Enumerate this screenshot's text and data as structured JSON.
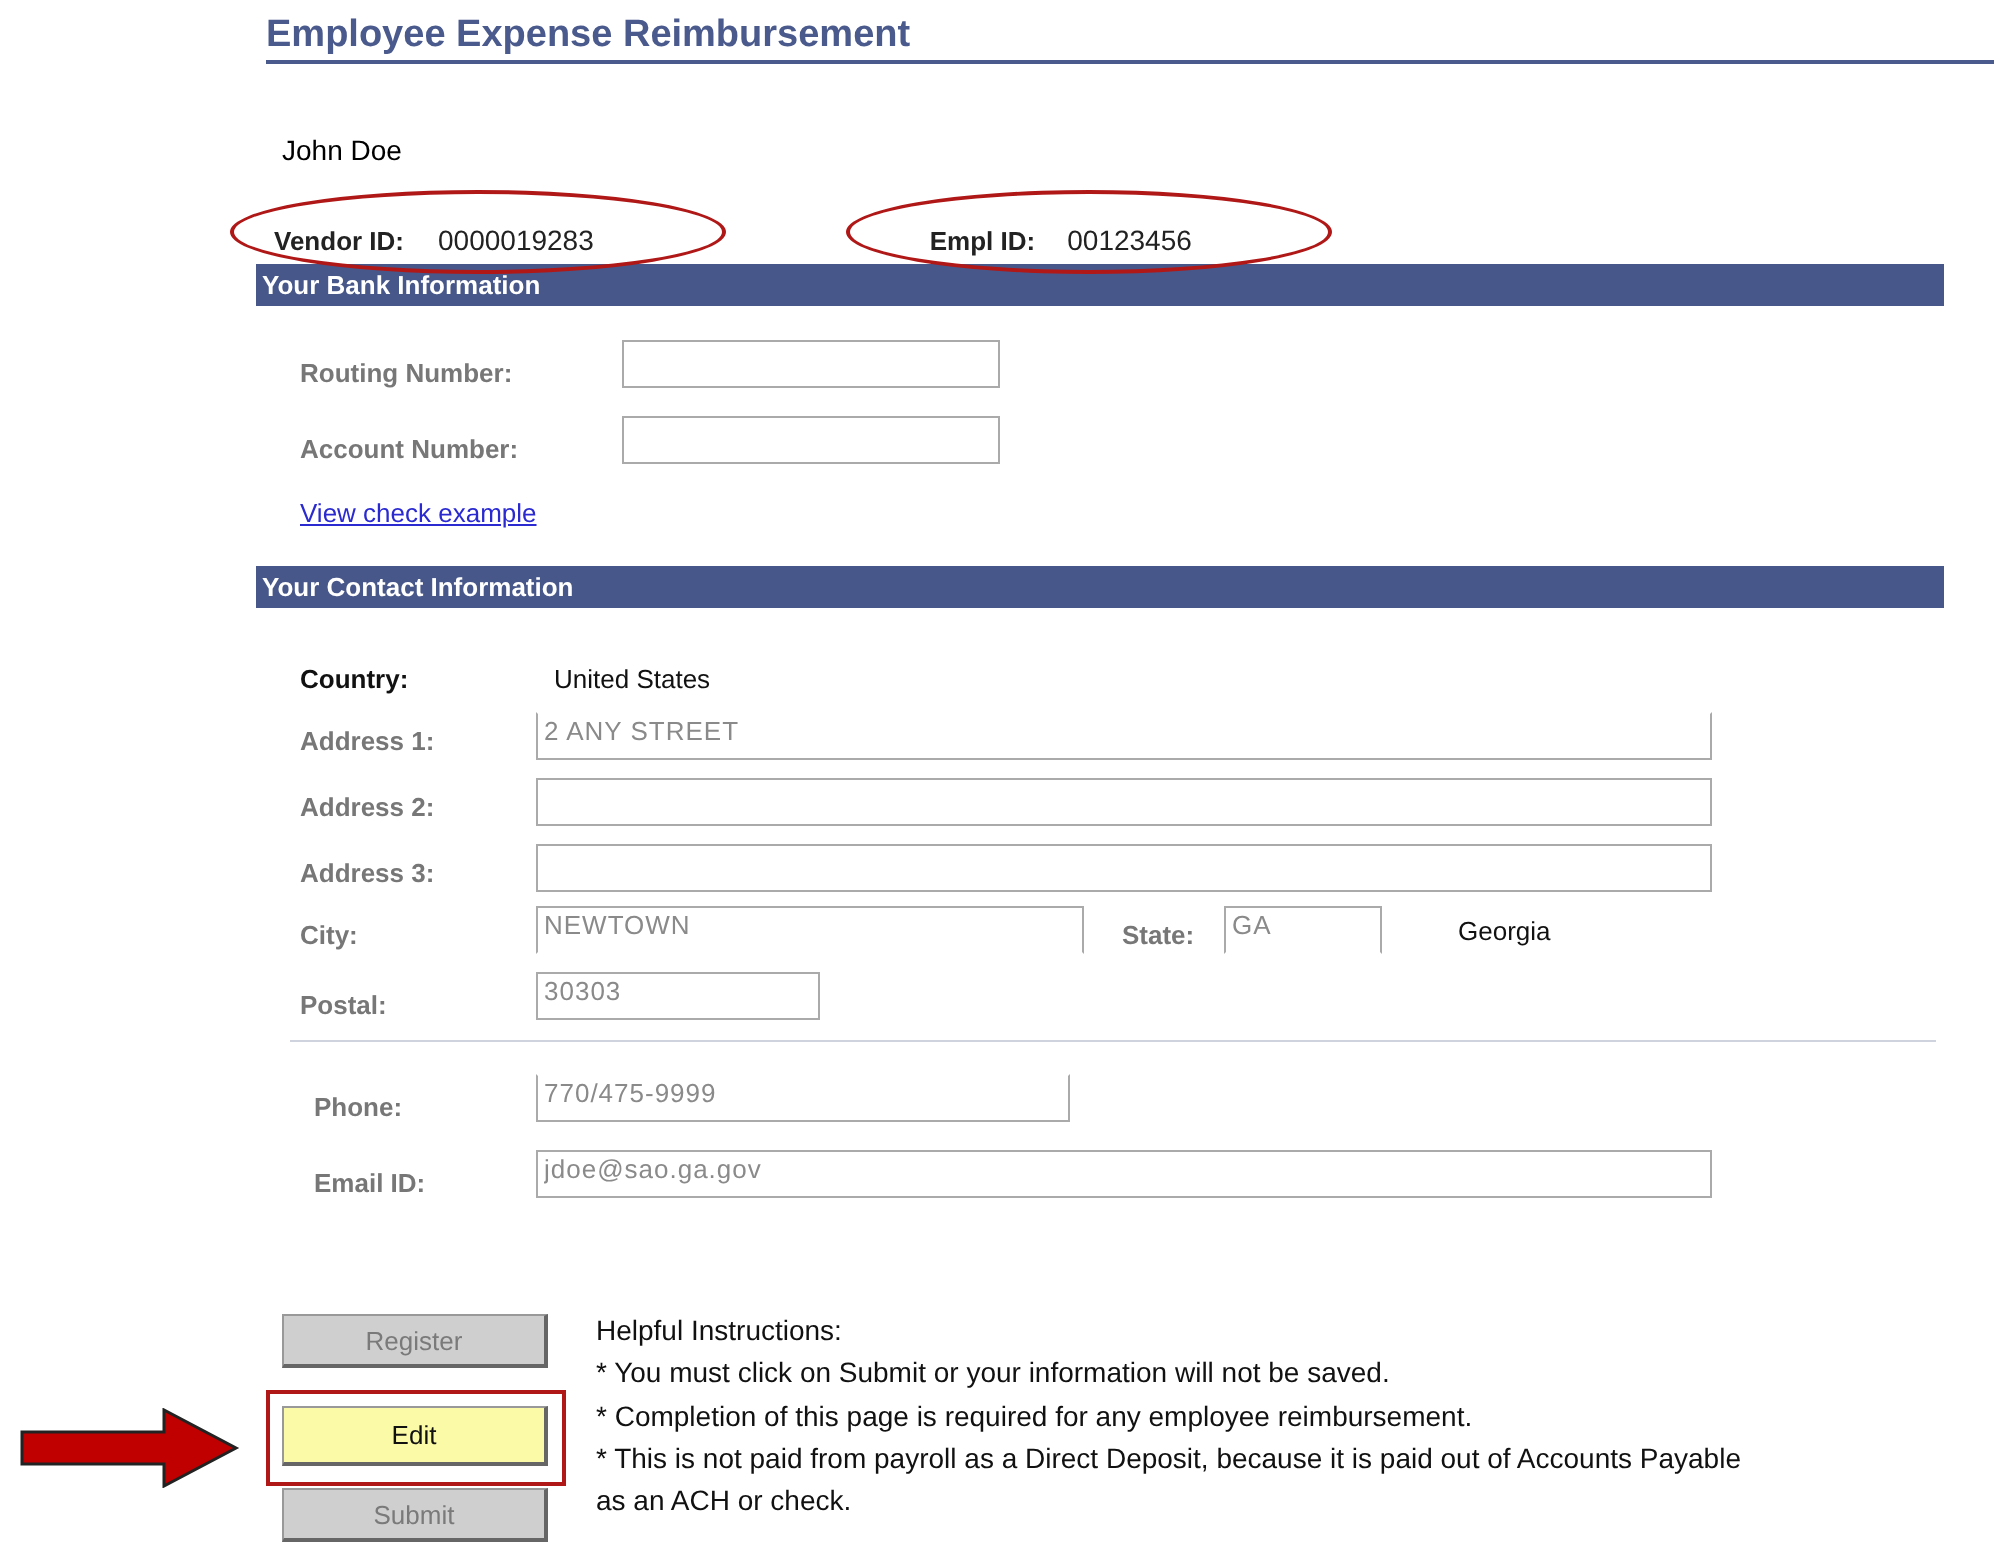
{
  "title": "Employee Expense Reimbursement",
  "employee_name": "John Doe",
  "ids": [
    {
      "label": "Vendor ID:",
      "value": "0000019283",
      "circled": true
    },
    {
      "label": "Empl ID:",
      "value": "00123456",
      "circled": true
    }
  ],
  "bank_section": {
    "heading": "Your Bank Information",
    "fields": [
      {
        "label": "Routing Number:"
      },
      {
        "label": "Account Number:"
      }
    ],
    "link": "View check example"
  },
  "contact_section": {
    "heading": "Your Contact Information",
    "country": {
      "label": "Country:",
      "value": "United States"
    },
    "addresses": [
      {
        "label": "Address 1:",
        "value": "2 ANY STREET"
      },
      {
        "label": "Address 2:"
      },
      {
        "label": "Address 3:"
      }
    ],
    "city": {
      "label": "City:",
      "value": "NEWTOWN"
    },
    "state": {
      "label": "State:",
      "value": "GA",
      "name": "Georgia"
    },
    "postal": {
      "label": "Postal:",
      "value": "30303"
    },
    "phone": {
      "label": "Phone:",
      "value": "770/475-9999"
    },
    "email": {
      "label": "Email ID:",
      "value": "jdoe@sao.ga.gov"
    }
  },
  "buttons": [
    {
      "label": "Register",
      "disabled": true,
      "highlighted": false
    },
    {
      "label": "Edit",
      "disabled": false,
      "highlighted": true
    },
    {
      "label": "Submit",
      "disabled": true,
      "highlighted": false
    }
  ],
  "instructions": {
    "heading": "Helpful Instructions:",
    "lines": [
      "* You must click on Submit or your information will not be saved.",
      "* Completion of this page is required for any employee reimbursement.",
      "* This is not paid from payroll as a Direct Deposit, because it is paid out of Accounts Payable as an ACH or check."
    ]
  }
}
